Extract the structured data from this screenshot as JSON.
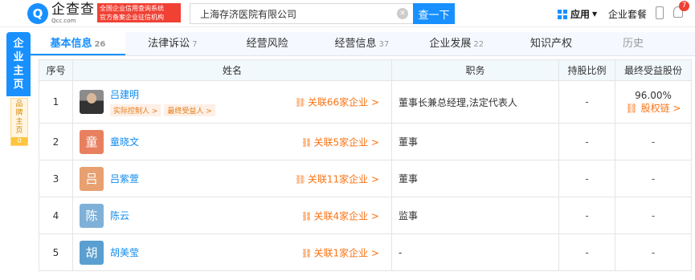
{
  "header": {
    "logo_mark": "Q",
    "logo_cn": "企查查",
    "logo_en": "Qcc.com",
    "cert_line1": "全国企业信用查询系统",
    "cert_line2": "官方备案企业征信机构",
    "search_value": "上海存济医院有限公司",
    "search_button": "查一下",
    "app_menu": "应用",
    "vip_menu": "企业套餐",
    "notification_count": "7"
  },
  "side": {
    "main_label": [
      "企",
      "业",
      "主",
      "页"
    ],
    "brand_label": [
      "品",
      "牌",
      "主",
      "页"
    ],
    "brand_count": "0"
  },
  "tabs": [
    {
      "label": "基本信息",
      "count": "26",
      "active": true
    },
    {
      "label": "法律诉讼",
      "count": "7"
    },
    {
      "label": "经营风险",
      "count": ""
    },
    {
      "label": "经营信息",
      "count": "37"
    },
    {
      "label": "企业发展",
      "count": "22"
    },
    {
      "label": "知识产权",
      "count": ""
    },
    {
      "label": "历史",
      "count": ""
    }
  ],
  "table": {
    "headers": [
      "序号",
      "姓名",
      "职务",
      "持股比例",
      "最终受益股份"
    ],
    "rows": [
      {
        "index": "1",
        "avatar": "",
        "avatar_color": "",
        "name": "吕建明",
        "tags": [
          "实际控制人 >",
          "最终受益人 >"
        ],
        "related": "关联66家企业 >",
        "position": "董事长兼总经理,法定代表人",
        "shareholding": "-",
        "beneficial_pct": "96.00%",
        "beneficial_link": "股权链 >"
      },
      {
        "index": "2",
        "avatar": "童",
        "avatar_color": "#e8805f",
        "name": "童晓文",
        "tags": [],
        "related": "关联5家企业 >",
        "position": "董事",
        "shareholding": "-",
        "beneficial": "-"
      },
      {
        "index": "3",
        "avatar": "吕",
        "avatar_color": "#e8a070",
        "name": "吕紫萱",
        "tags": [],
        "related": "关联11家企业 >",
        "position": "董事",
        "shareholding": "-",
        "beneficial": "-"
      },
      {
        "index": "4",
        "avatar": "陈",
        "avatar_color": "#7fb0d8",
        "name": "陈云",
        "tags": [],
        "related": "关联4家企业 >",
        "position": "监事",
        "shareholding": "-",
        "beneficial": "-"
      },
      {
        "index": "5",
        "avatar": "胡",
        "avatar_color": "#5a9fd0",
        "name": "胡美莹",
        "tags": [],
        "related": "关联1家企业 >",
        "position": "-",
        "shareholding": "-",
        "beneficial": "-"
      }
    ]
  },
  "colors": {
    "brand_blue": "#1890ff",
    "link_blue": "#128bed",
    "orange": "#fa7314",
    "cert_red": "#f04134"
  }
}
